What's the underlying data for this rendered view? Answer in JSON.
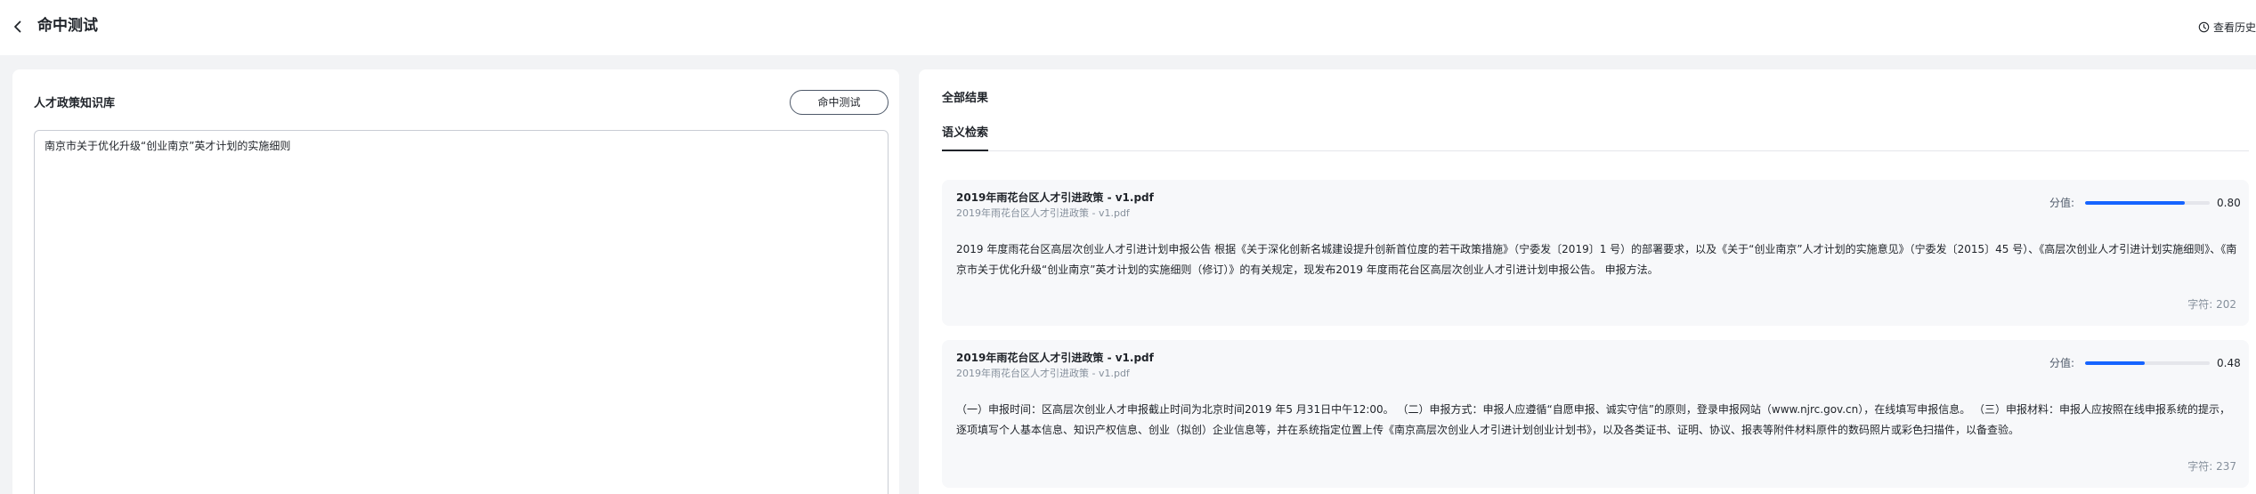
{
  "header": {
    "title": "命中测试",
    "history_label": "查看历史"
  },
  "knowledge_base": {
    "title": "人才政策知识库",
    "hit_test_button": "命中测试",
    "query_text": "南京市关于优化升级“创业南京”英才计划的实施细则"
  },
  "results": {
    "title": "全部结果",
    "tabs": [
      {
        "label": "语义检索",
        "active": true
      }
    ],
    "score_label": "分值:",
    "cards": [
      {
        "filename": "2019年雨花台区人才引进政策 - v1.pdf",
        "subtitle": "2019年雨花台区人才引进政策 - v1.pdf",
        "score": 0.8,
        "score_text": "0.80",
        "content": "2019 年度雨花台区高层次创业人才引进计划申报公告 根据《关于深化创新名城建设提升创新首位度的若干政策措施》（宁委发〔2019〕1 号）的部署要求，以及《关于“创业南京”人才计划的实施意见》（宁委发〔2015〕45 号）、《高层次创业人才引进计划实施细则》、《南京市关于优化升级“创业南京”英才计划的实施细则（修订）》的有关规定，现发布2019 年度雨花台区高层次创业人才引进计划申报公告。 申报方法。",
        "char_count": "字符: 202"
      },
      {
        "filename": "2019年雨花台区人才引进政策 - v1.pdf",
        "subtitle": "2019年雨花台区人才引进政策 - v1.pdf",
        "score": 0.48,
        "score_text": "0.48",
        "content": "（一）申报时间：区高层次创业人才申报截止时间为北京时间2019 年5 月31日中午12:00。 （二）申报方式：申报人应遵循“自愿申报、诚实守信”的原则，登录申报网站（www.njrc.gov.cn），在线填写申报信息。 （三）申报材料：申报人应按照在线申报系统的提示，逐项填写个人基本信息、知识产权信息、创业（拟创）企业信息等，并在系统指定位置上传《南京高层次创业人才引进计划创业计划书》，以及各类证书、证明、协议、报表等附件材料原件的数码照片或彩色扫描件，以备查验。",
        "char_count": "字符: 237"
      }
    ]
  },
  "colors": {
    "accent": "#1664ff",
    "page_bg": "#f2f3f5",
    "card_bg": "#f7f8fa",
    "muted_text": "#86909c"
  }
}
